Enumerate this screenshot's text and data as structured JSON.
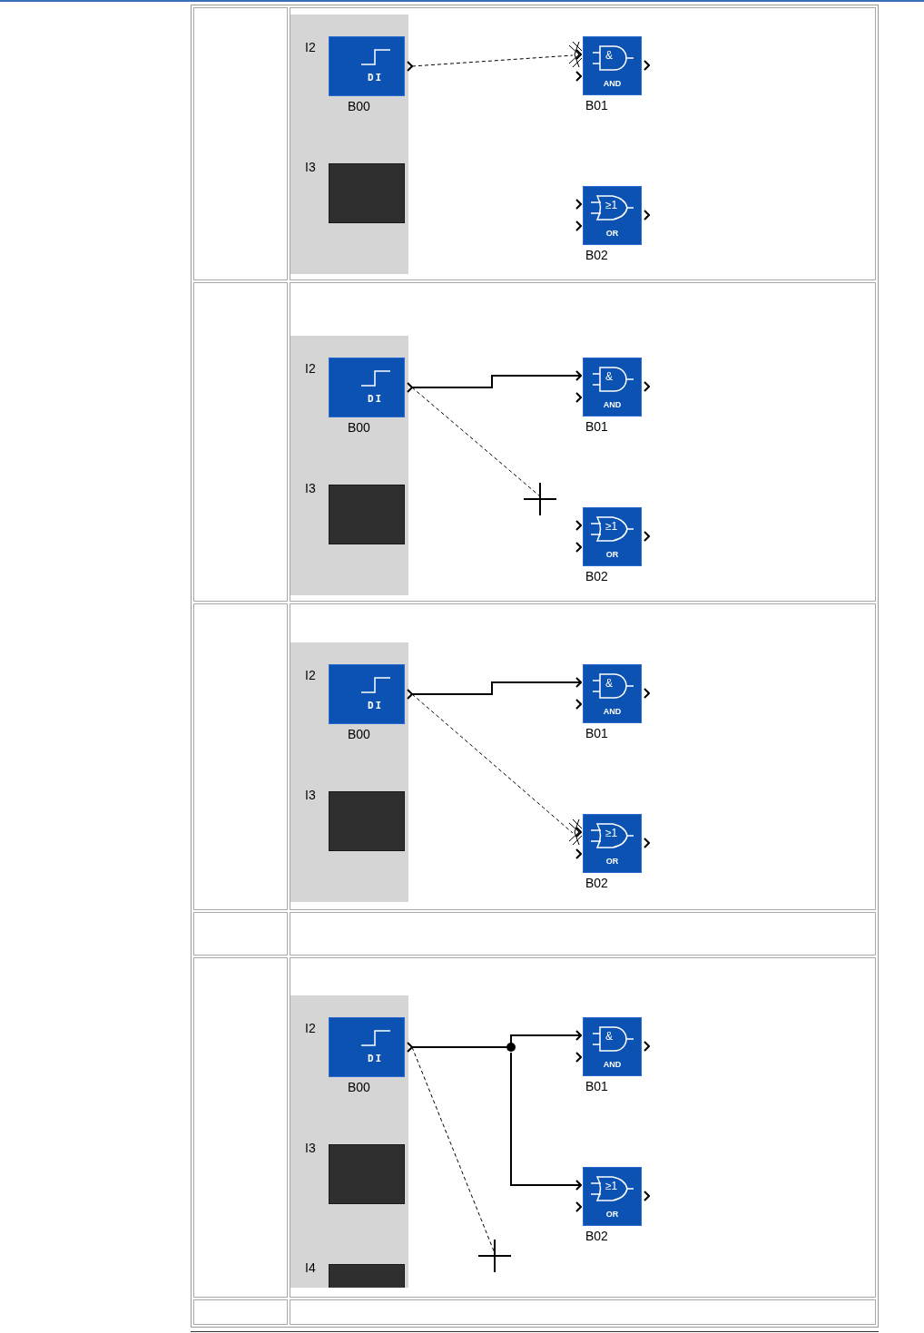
{
  "table": {
    "rows": [
      {
        "kind": "diagram",
        "diagram": {
          "inputs": [
            {
              "label": "I2",
              "kind": "di",
              "block": "DI",
              "name": "B00"
            },
            {
              "label": "I3",
              "kind": "unused"
            }
          ],
          "gates": [
            {
              "kind": "and",
              "symbol": "&",
              "text": "AND",
              "name": "B01"
            },
            {
              "kind": "or",
              "symbol": "≥1",
              "text": "OR",
              "name": "B02"
            }
          ],
          "wires": [
            {
              "kind": "pending",
              "to_second_gate": false
            }
          ]
        }
      },
      {
        "kind": "diagram",
        "diagram": {
          "inputs": [
            {
              "label": "I2",
              "kind": "di",
              "block": "DI",
              "name": "B00"
            },
            {
              "label": "I3",
              "kind": "unused"
            }
          ],
          "gates": [
            {
              "kind": "and",
              "symbol": "&",
              "text": "AND",
              "name": "B01"
            },
            {
              "kind": "or",
              "symbol": "≥1",
              "text": "OR",
              "name": "B02"
            }
          ],
          "wires": [
            {
              "kind": "connected",
              "to_second_gate": false
            },
            {
              "kind": "to_cursor"
            }
          ]
        }
      },
      {
        "kind": "diagram",
        "diagram": {
          "inputs": [
            {
              "label": "I2",
              "kind": "di",
              "block": "DI",
              "name": "B00"
            },
            {
              "label": "I3",
              "kind": "unused"
            }
          ],
          "gates": [
            {
              "kind": "and",
              "symbol": "&",
              "text": "AND",
              "name": "B01"
            },
            {
              "kind": "or",
              "symbol": "≥1",
              "text": "OR",
              "name": "B02"
            }
          ],
          "wires": [
            {
              "kind": "connected",
              "to_second_gate": false
            },
            {
              "kind": "pending",
              "to_second_gate": true
            }
          ]
        }
      },
      {
        "kind": "blank"
      },
      {
        "kind": "diagram",
        "diagram": {
          "inputs": [
            {
              "label": "I2",
              "kind": "di",
              "block": "DI",
              "name": "B00"
            },
            {
              "label": "I3",
              "kind": "unused"
            },
            {
              "label": "I4",
              "kind": "unused"
            }
          ],
          "gates": [
            {
              "kind": "and",
              "symbol": "&",
              "text": "AND",
              "name": "B01"
            },
            {
              "kind": "or",
              "symbol": "≥1",
              "text": "OR",
              "name": "B02"
            }
          ],
          "wires": [
            {
              "kind": "connected",
              "to_second_gate": false
            },
            {
              "kind": "connected",
              "to_second_gate": true
            },
            {
              "kind": "to_cursor"
            }
          ]
        }
      },
      {
        "kind": "blank"
      }
    ]
  }
}
